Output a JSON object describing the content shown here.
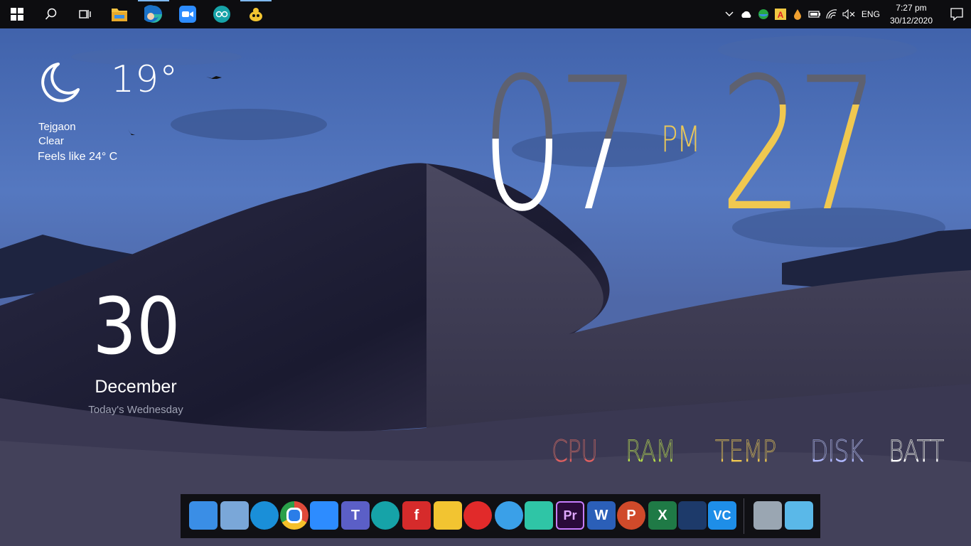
{
  "taskbar": {
    "start": {
      "icon": "windows-logo-icon"
    },
    "search": {
      "icon": "search-icon"
    },
    "task_view": {
      "icon": "task-view-icon"
    },
    "pinned": [
      {
        "name": "file-explorer",
        "icon": "folder-icon",
        "active": false
      },
      {
        "name": "microsoft-edge",
        "icon": "edge-icon",
        "active": true
      },
      {
        "name": "zoom",
        "icon": "zoom-icon",
        "active": false
      },
      {
        "name": "arduino",
        "icon": "arduino-icon",
        "active": false
      },
      {
        "name": "genie",
        "icon": "genie-lamp-icon",
        "active": true
      }
    ],
    "tray": {
      "chevron": "chevron-up-icon",
      "icons": [
        "onedrive-cloud-icon",
        "globe-app-icon",
        "font-app-icon",
        "droplet-icon",
        "battery-icon",
        "wifi-icon",
        "volume-muted-icon"
      ],
      "language": "ENG",
      "time": "7:27 pm",
      "date": "30/12/2020",
      "notification_icon": "action-center-icon"
    }
  },
  "weather": {
    "icon": "moon-icon",
    "temperature": "19°",
    "location": "Tejgaon",
    "condition": "Clear",
    "feels_like": "Feels like 24° C"
  },
  "clock": {
    "hours": "07",
    "minutes": "27",
    "ampm": "PM",
    "colors": {
      "hours_top": "#5e6170",
      "hours_bottom": "#ffffff",
      "minutes_top": "#5e6170",
      "minutes_bottom": "#f0c850"
    }
  },
  "date": {
    "day": "30",
    "month": "December",
    "weekday": "Today's Wednesday"
  },
  "meters": [
    {
      "label": "CPU",
      "top_color": "#4a4a58",
      "bottom_color": "#e06060"
    },
    {
      "label": "RAM",
      "top_color": "#4a4a58",
      "bottom_color": "#b8e04a"
    },
    {
      "label": "TEMP",
      "top_color": "#4a4a58",
      "bottom_color": "#f0c850"
    },
    {
      "label": "DISK",
      "top_color": "#4a4a58",
      "bottom_color": "#b0b8ff"
    },
    {
      "label": "BATT",
      "top_color": "#4a4a58",
      "bottom_color": "#ffffff"
    }
  ],
  "dock": {
    "apps": [
      {
        "name": "this-pc",
        "icon": "computer-icon",
        "letter": "",
        "color": "#3a8ee6"
      },
      {
        "name": "control-panel",
        "icon": "control-panel-icon",
        "letter": "",
        "color": "#7aa7d8"
      },
      {
        "name": "edge",
        "icon": "edge-icon",
        "letter": "",
        "color": "#1a8fd8"
      },
      {
        "name": "chrome",
        "icon": "chrome-icon",
        "letter": "",
        "color": "#e04a3a"
      },
      {
        "name": "zoom",
        "icon": "zoom-icon",
        "letter": "",
        "color": "#2d8cff"
      },
      {
        "name": "teams",
        "icon": "teams-icon",
        "letter": "T",
        "color": "#5b5fc7"
      },
      {
        "name": "arduino",
        "icon": "arduino-icon",
        "letter": "",
        "color": "#16a3a8"
      },
      {
        "name": "fonts-app",
        "icon": "f-app-icon",
        "letter": "f",
        "color": "#d62b2b"
      },
      {
        "name": "genie",
        "icon": "genie-lamp-icon",
        "letter": "",
        "color": "#f2c431"
      },
      {
        "name": "acrobat",
        "icon": "acrobat-icon",
        "letter": "",
        "color": "#e12a2a"
      },
      {
        "name": "video-app",
        "icon": "video-camera-icon",
        "letter": "",
        "color": "#3aa0e8"
      },
      {
        "name": "filmora",
        "icon": "filmora-icon",
        "letter": "",
        "color": "#2fc5a6"
      },
      {
        "name": "premiere-pro",
        "icon": "premiere-pro-icon",
        "letter": "Pr",
        "color": "#2a0a3a"
      },
      {
        "name": "word",
        "icon": "word-icon",
        "letter": "W",
        "color": "#2b5fb8"
      },
      {
        "name": "powerpoint",
        "icon": "powerpoint-icon",
        "letter": "P",
        "color": "#d04a2a"
      },
      {
        "name": "excel",
        "icon": "excel-icon",
        "letter": "X",
        "color": "#1f7a46"
      },
      {
        "name": "wondershare",
        "icon": "wondershare-icon",
        "letter": "",
        "color": "#1d3a6a"
      },
      {
        "name": "vnc",
        "icon": "vnc-icon",
        "letter": "VC",
        "color": "#1e8ee8"
      },
      {
        "name": "recycle-bin",
        "icon": "recycle-bin-icon",
        "letter": "",
        "color": "#9aa6b2"
      },
      {
        "name": "desktop",
        "icon": "desktop-icon",
        "letter": "",
        "color": "#5ab8e8"
      }
    ]
  }
}
